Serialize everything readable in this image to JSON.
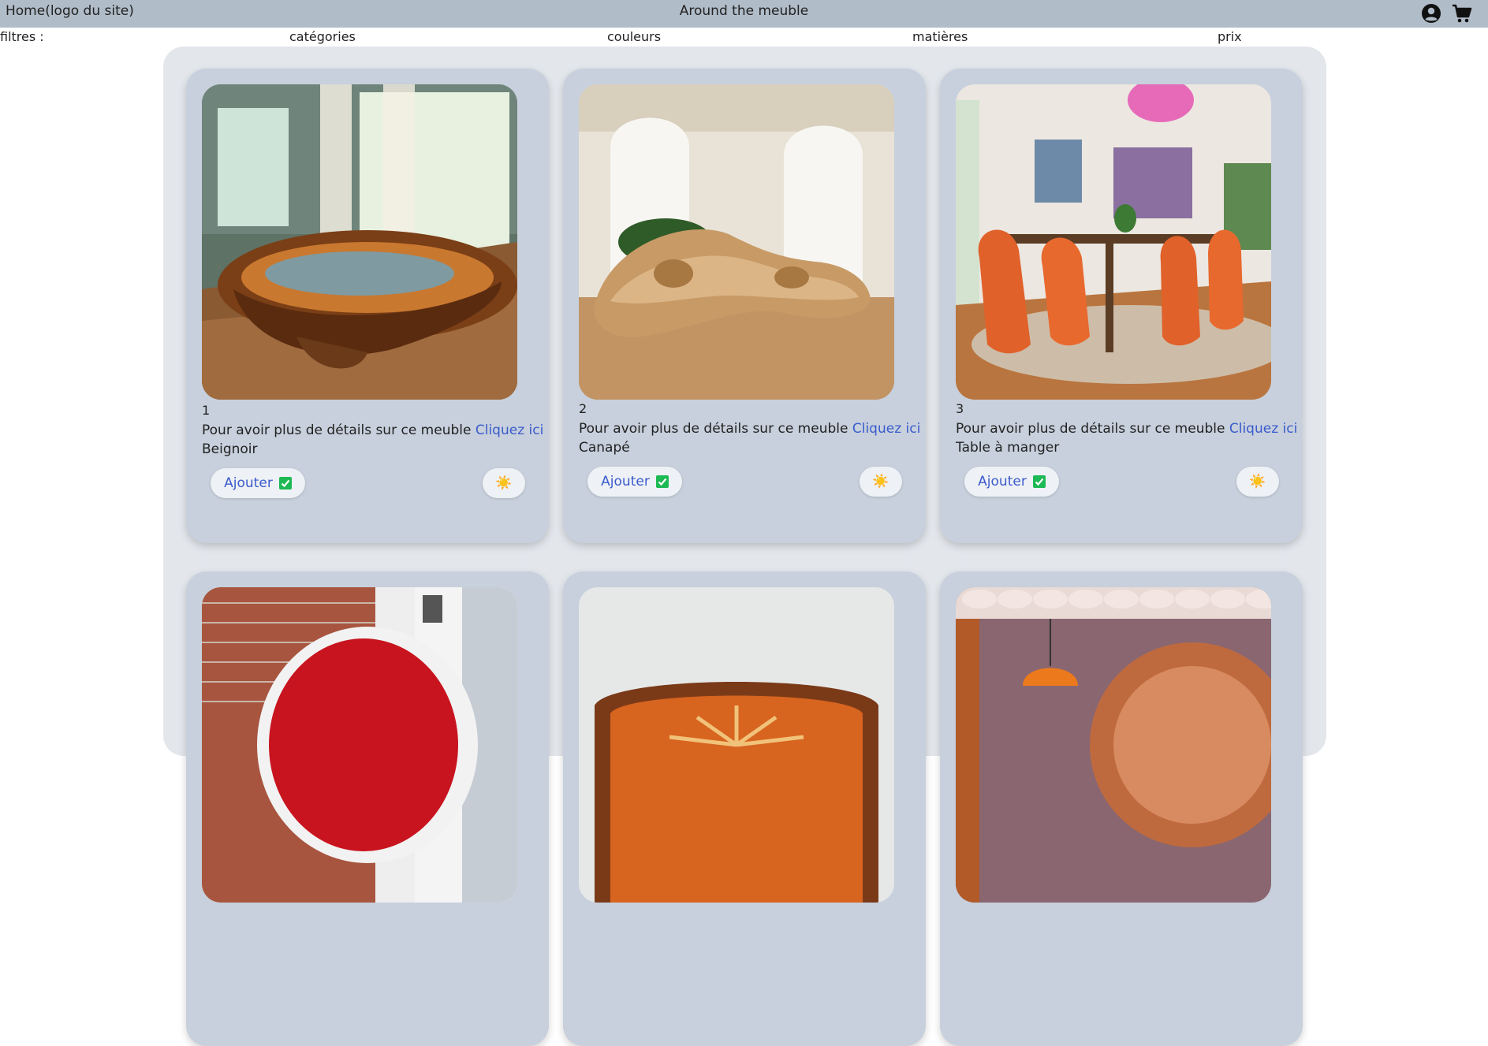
{
  "header": {
    "home_label": "Home(logo du site)",
    "title": "Around the meuble",
    "user_icon": "user-circle-icon",
    "cart_icon": "cart-icon"
  },
  "filters": {
    "label": "filtres :",
    "items": [
      "catégories",
      "couleurs",
      "matières",
      "prix"
    ]
  },
  "cards": [
    {
      "number": "1",
      "details_text": "Pour avoir plus de détails sur ce meuble",
      "link_label": "Cliquez ici",
      "name": "Beignoir",
      "add_label": "Ajouter",
      "sun_icon": "☀️"
    },
    {
      "number": "2",
      "details_text": "Pour avoir plus de détails sur ce meuble",
      "link_label": "Cliquez ici",
      "name": "Canapé",
      "add_label": "Ajouter",
      "sun_icon": "☀️"
    },
    {
      "number": "3",
      "details_text": "Pour avoir plus de détails sur ce meuble",
      "link_label": "Cliquez ici",
      "name": "Table à manger",
      "add_label": "Ajouter",
      "sun_icon": "☀️"
    }
  ],
  "colors": {
    "header_bg": "#b0bcc8",
    "panel_bg": "#e3e7ec",
    "card_bg": "#c7d0dc",
    "link": "#3b5bcc",
    "check": "#1db954"
  }
}
